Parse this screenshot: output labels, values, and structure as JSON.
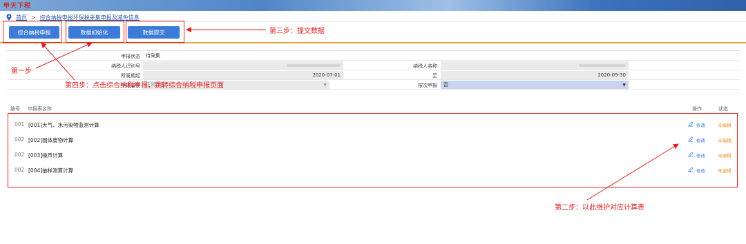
{
  "header": {
    "logo_text": "甲天下税",
    "banner_color": "#4f86c8"
  },
  "breadcrumb": {
    "home": "首页",
    "separator": ">",
    "current": "综合纳税申报环保税采集申报及减免信息"
  },
  "toolbar": {
    "btn_integrated": "综合纳税申报",
    "btn_init": "数据初始化",
    "btn_submit": "数据提交"
  },
  "form": {
    "status_label": "申报状态",
    "status_value": "待采集",
    "taxpayer_id_label": "纳税人识别号",
    "taxpayer_name_label": "纳税人名称",
    "period_label": "所属期起",
    "period_start": "2020-07-01",
    "to_label": "至",
    "period_end": "2020-09-30",
    "attr_label": "申报属性",
    "attr_value": "正常申报",
    "by_times_label": "按次申报",
    "by_times_value": "否"
  },
  "table": {
    "col_no": "编号",
    "col_name": "申报表名称",
    "col_op": "操作",
    "col_status": "状态",
    "rows": [
      {
        "no": "001",
        "name": "[001]大气、水污染物监测计算",
        "op": "修改",
        "status": "未编辑"
      },
      {
        "no": "002",
        "name": "[002]固体废物计算",
        "op": "修改",
        "status": "未编辑"
      },
      {
        "no": "002",
        "name": "[003]噪声计算",
        "op": "修改",
        "status": "未编辑"
      },
      {
        "no": "002",
        "name": "[004]抽样测算计算",
        "op": "修改",
        "status": "未编辑"
      }
    ]
  },
  "annotations": {
    "step1": "第一步",
    "step2": "第二步：以此维护对应计算表",
    "step3": "第三步：提交数据",
    "step4": "第四步：点击综合纳税申报，跳转综合纳税申报页面"
  },
  "colors": {
    "primary": "#3d7bd9",
    "annotation": "#e02020",
    "status_pending": "#e8942a",
    "accent_line": "#e8a33a"
  }
}
